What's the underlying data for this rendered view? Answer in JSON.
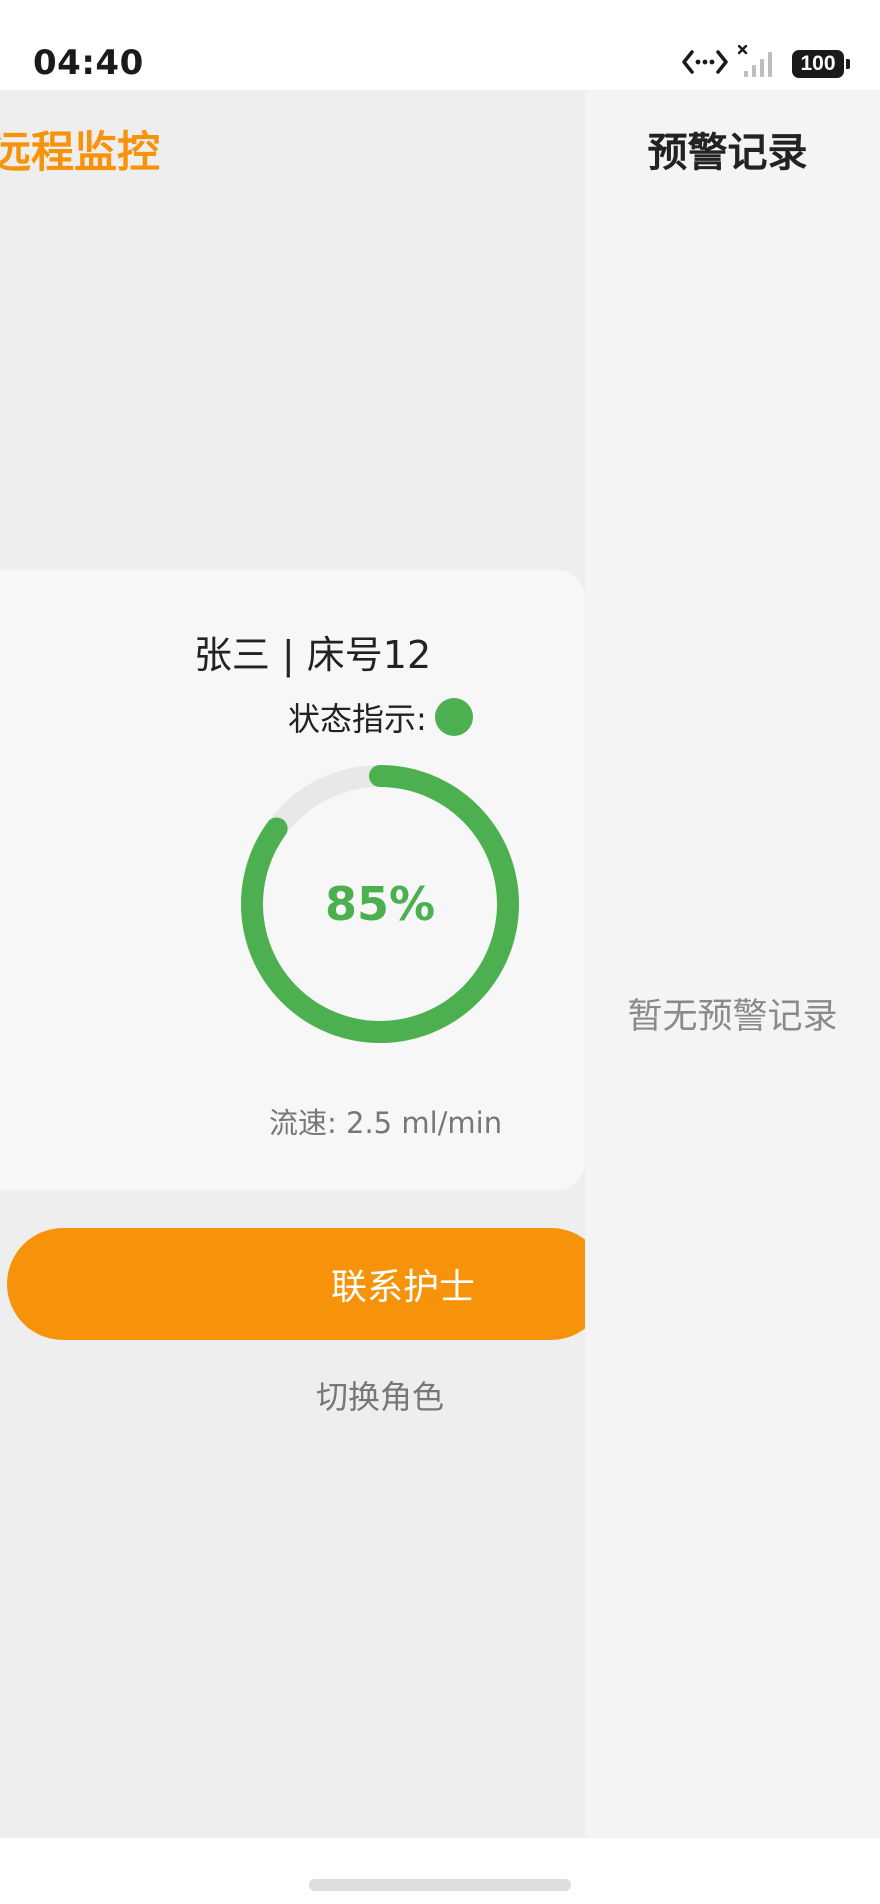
{
  "status_bar": {
    "time": "04:40",
    "battery": "100",
    "icons": [
      "data-transfer-icon",
      "signal-icon",
      "battery-icon"
    ]
  },
  "main": {
    "title": "远程监控",
    "card": {
      "patient": "张三 | 床号12",
      "status_label": "状态指示:",
      "status_color": "#4caf50",
      "progress_text": "85%",
      "progress_value": 0.85,
      "flow_rate": "流速: 2.5 ml/min"
    },
    "contact_button_label": "联系护士",
    "switch_role_label": "切换角色"
  },
  "drawer": {
    "title": "预警记录",
    "empty_text": "暂无预警记录"
  },
  "colors": {
    "accent": "#f7930a",
    "success": "#4caf50"
  }
}
